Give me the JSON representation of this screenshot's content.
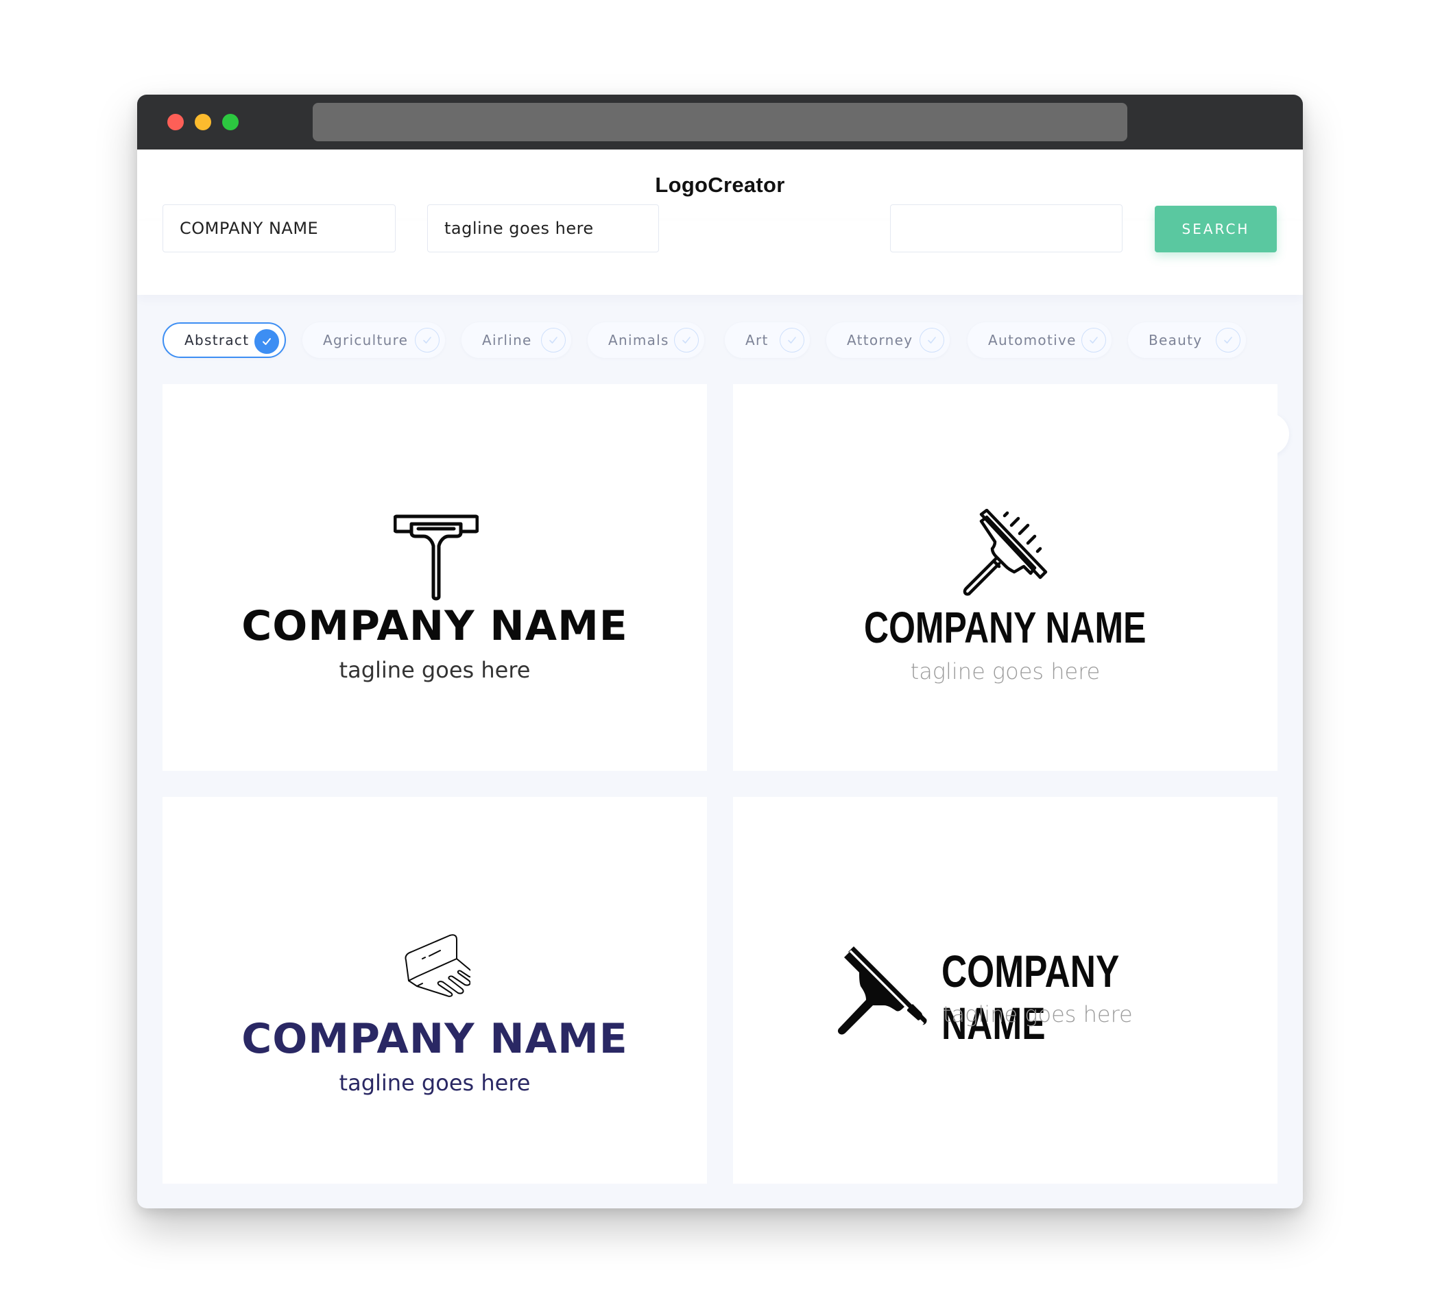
{
  "window": {
    "controls": [
      "close",
      "minimize",
      "maximize"
    ],
    "url": ""
  },
  "header": {
    "brand": "LogoCreator"
  },
  "search": {
    "company_name_value": "COMPANY NAME",
    "tagline_value": "tagline goes here",
    "keyword_value": "",
    "button_label": "SEARCH"
  },
  "categories": {
    "items": [
      {
        "label": "Abstract",
        "selected": true
      },
      {
        "label": "Agriculture",
        "selected": false
      },
      {
        "label": "Airline",
        "selected": false
      },
      {
        "label": "Animals",
        "selected": false
      },
      {
        "label": "Art",
        "selected": false
      },
      {
        "label": "Attorney",
        "selected": false
      },
      {
        "label": "Automotive",
        "selected": false
      },
      {
        "label": "Beauty",
        "selected": false
      }
    ],
    "next_icon": "arrow-right-icon"
  },
  "logos": [
    {
      "icon": "squeegee-outline-icon",
      "company": "COMPANY NAME",
      "tagline": "tagline goes here",
      "color": "#0a0a0a"
    },
    {
      "icon": "squeegee-wiping-icon",
      "company": "COMPANY NAME",
      "tagline": "tagline goes here",
      "color": "#0a0a0a"
    },
    {
      "icon": "squeegee-trace-icon",
      "company": "COMPANY NAME",
      "tagline": "tagline goes here",
      "color": "#2a2864"
    },
    {
      "icon": "squeegee-solid-icon",
      "company": "COMPANY NAME",
      "tagline": "tagline goes here",
      "color": "#0a0a0a"
    }
  ],
  "colors": {
    "accent": "#3d8ef3",
    "search_button": "#5ac8a0",
    "titlebar": "#303133",
    "page_bg": "#f5f7fc"
  }
}
